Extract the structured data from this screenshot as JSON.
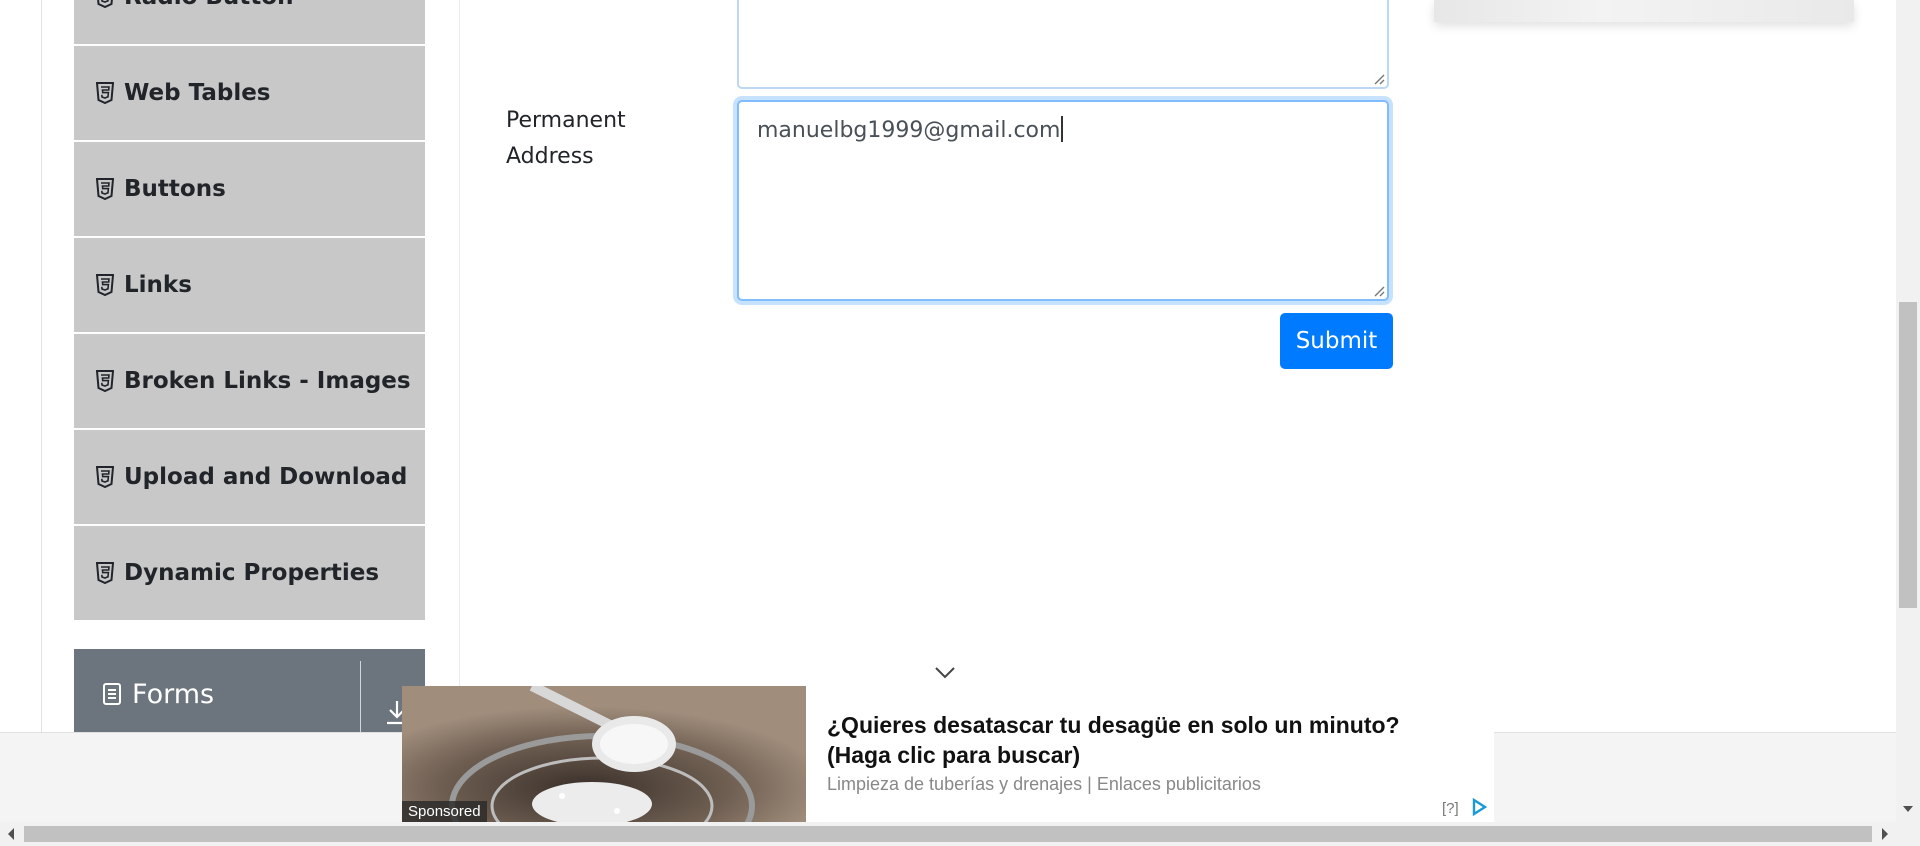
{
  "sidebar": {
    "items": [
      {
        "label": "Radio Button",
        "icon": "html5-icon"
      },
      {
        "label": "Web Tables",
        "icon": "html5-icon"
      },
      {
        "label": "Buttons",
        "icon": "html5-icon"
      },
      {
        "label": "Links",
        "icon": "html5-icon"
      },
      {
        "label": "Broken Links - Images",
        "icon": "html5-icon"
      },
      {
        "label": "Upload and Download",
        "icon": "html5-icon"
      },
      {
        "label": "Dynamic Properties",
        "icon": "html5-icon"
      }
    ],
    "group": {
      "label": "Forms",
      "icon": "document-icon",
      "toggle_icon": "download-arrow-icon"
    }
  },
  "form": {
    "permanent_address": {
      "label": "Permanent Address",
      "value": "manuelbg1999@gmail.com",
      "focused": true
    },
    "submit_label": "Submit"
  },
  "ad": {
    "sponsored_label": "Sponsored",
    "headline": "¿Quieres desatascar tu desagüe en solo un minuto? (Haga clic para buscar)",
    "source": "Limpieza de tuberías y drenajes | Enlaces publicitarios",
    "help_label": "[?]",
    "choice_icon": "adchoices-icon"
  },
  "colors": {
    "primary": "#007bff",
    "sidebar_item_bg": "#c8c8c8",
    "group_header_bg": "#6c757d",
    "focus_border": "#80bdff"
  }
}
